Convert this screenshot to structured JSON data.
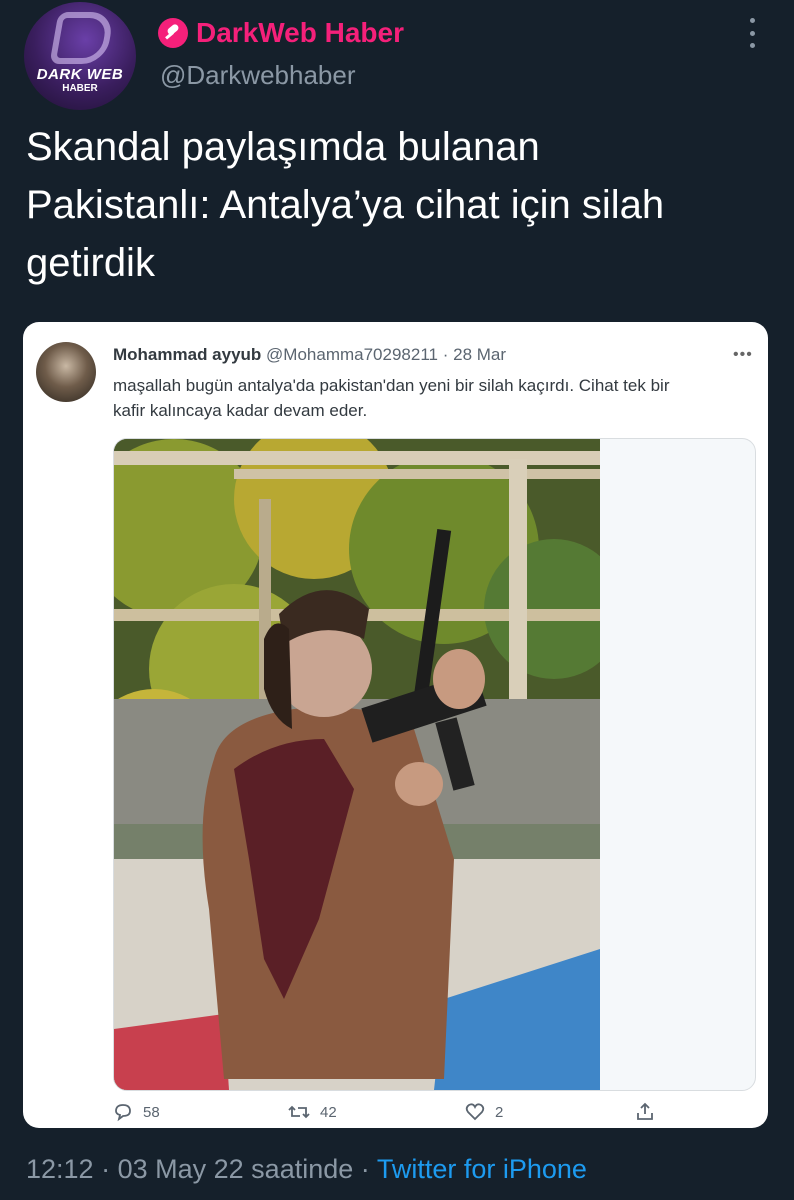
{
  "header": {
    "avatar_brand": "DARK WEB",
    "avatar_brand_sub": "HABER",
    "display_name": "DarkWeb Haber",
    "handle": "@Darkwebhaber"
  },
  "tweet": {
    "text": "Skandal paylaşımda bulanan\nPakistanlı: Antalya’ya cihat için silah\ngetirdik"
  },
  "embedded": {
    "name": "Mohammad ayyub",
    "handle": "@Mohamma70298211",
    "sep": "·",
    "date": "28 Mar",
    "text": "maşallah bugün antalya'da pakistan'dan yeni bir silah kaçırdı. Cihat tek bir\nkafir kalıncaya kadar devam eder.",
    "more": "•••",
    "actions": {
      "replies": "58",
      "retweets": "42",
      "likes": "2"
    }
  },
  "meta": {
    "time": "12:12",
    "sep1": "·",
    "date": "03 May 22 saatinde",
    "sep2": "·",
    "source": "Twitter for iPhone"
  },
  "colors": {
    "background": "#15202b",
    "accent": "#f5207a",
    "link": "#1d9bf0",
    "muted": "#8b98a5"
  }
}
